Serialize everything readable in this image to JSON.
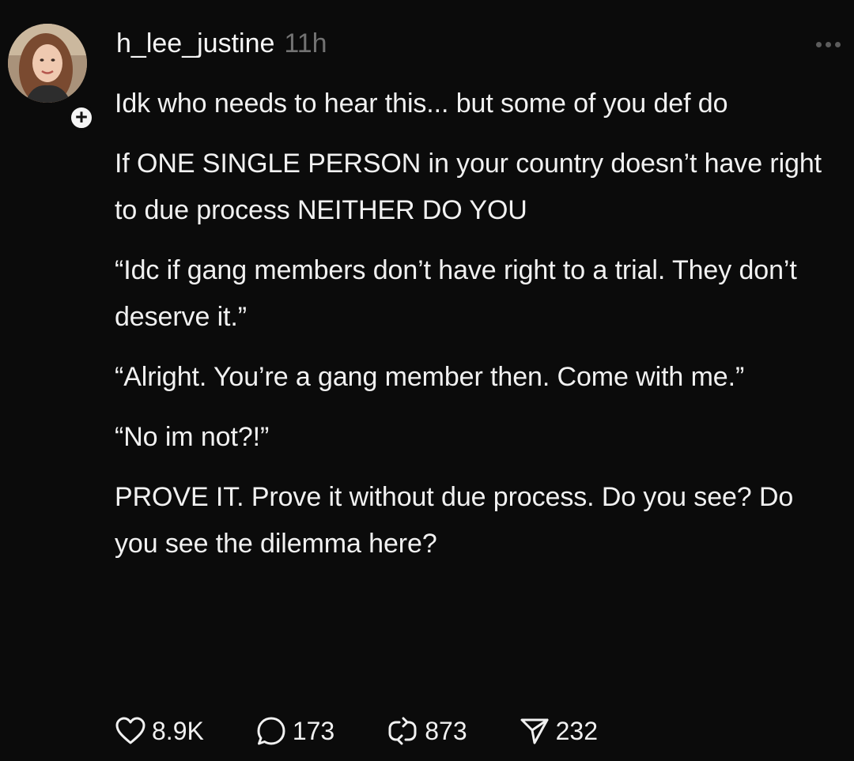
{
  "post": {
    "username": "h_lee_justine",
    "timestamp": "11h",
    "follow_badge": "+",
    "paragraphs": [
      "Idk who needs to hear this... but some of you def do",
      "If ONE SINGLE PERSON in your country doesn’t have right to due process NEITHER DO YOU",
      "“Idc if gang members don’t have right to a trial. They don’t deserve it.”",
      "“Alright. You’re a gang member then. Come with me.”",
      "“No im not?!”",
      "PROVE IT. Prove it without due process. Do you see? Do you see the dilemma here?"
    ]
  },
  "actions": {
    "likes": "8.9K",
    "replies": "173",
    "reposts": "873",
    "shares": "232"
  },
  "icons": {
    "like": "heart-icon",
    "reply": "comment-bubble-icon",
    "repost": "repost-arrows-icon",
    "share": "send-paper-plane-icon",
    "more": "more-dots-icon"
  },
  "colors": {
    "background": "#0b0b0b",
    "text": "#f1f1f1",
    "muted": "#727272"
  }
}
